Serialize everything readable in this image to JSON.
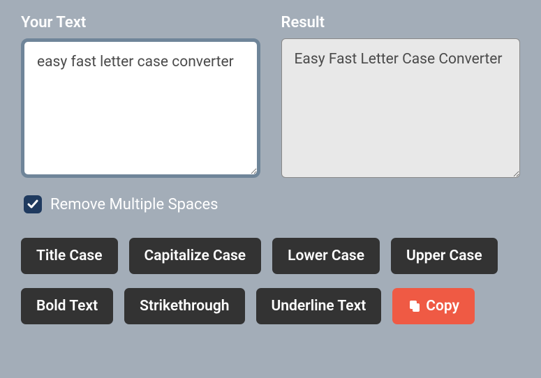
{
  "input": {
    "label": "Your Text",
    "value": "easy fast letter case converter"
  },
  "output": {
    "label": "Result",
    "value": "Easy Fast Letter Case Converter"
  },
  "checkbox": {
    "label": "Remove Multiple Spaces",
    "checked": true
  },
  "buttons": {
    "titleCase": "Title Case",
    "capitalizeCase": "Capitalize Case",
    "lowerCase": "Lower Case",
    "upperCase": "Upper Case",
    "boldText": "Bold Text",
    "strikethrough": "Strikethrough",
    "underlineText": "Underline Text",
    "copy": "Copy"
  }
}
